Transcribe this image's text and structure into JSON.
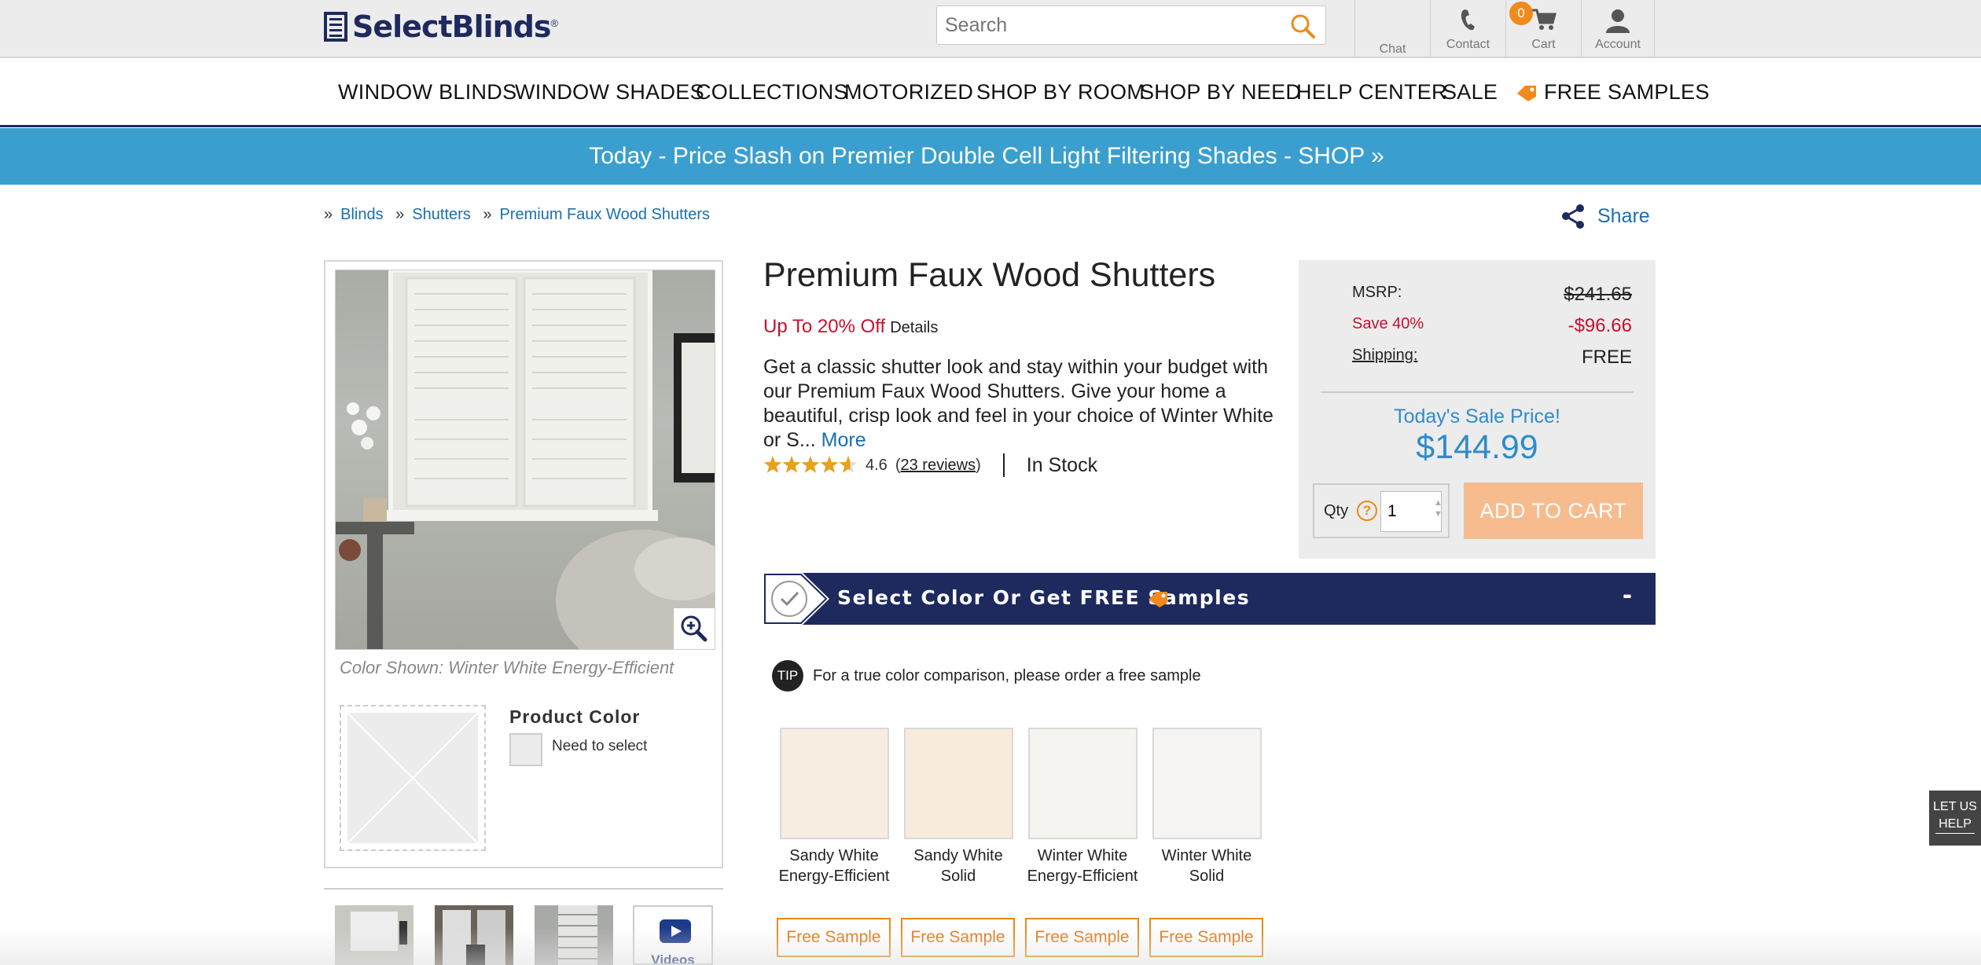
{
  "header": {
    "logo": "SelectBlinds",
    "logo_reg": "®",
    "search_placeholder": "Search",
    "chat": "Chat",
    "contact": "Contact",
    "cart": "Cart",
    "cart_count": "0",
    "account": "Account"
  },
  "nav": [
    "WINDOW BLINDS",
    "WINDOW SHADES",
    "COLLECTIONS",
    "MOTORIZED",
    "SHOP BY ROOM",
    "SHOP BY NEED",
    "HELP CENTER",
    "SALE",
    "FREE SAMPLES"
  ],
  "promo": "Today - Price Slash on Premier Double Cell Light Filtering Shades  -  SHOP »",
  "breadcrumb": [
    "Blinds",
    "Shutters",
    "Premium Faux Wood Shutters"
  ],
  "share": "Share",
  "gallery": {
    "caption": "Color Shown: Winter White Energy-Efficient",
    "product_color_label": "Product Color",
    "product_color_value": "Need to select",
    "videos_label": "Videos"
  },
  "product": {
    "title": "Premium Faux Wood Shutters",
    "discount": "Up To 20% Off",
    "details_link": "Details",
    "description": "Get a classic shutter look and stay within your budget with our Premium Faux Wood Shutters. Give your home a beautiful, crisp look and feel in your choice of Winter White or S...",
    "more_link": "More",
    "rating": 4.6,
    "rating_text": "4.6",
    "reviews_link": "23 reviews",
    "stock": "In Stock"
  },
  "pricing": {
    "msrp_label": "MSRP:",
    "msrp": "$241.65",
    "save_label": "Save 40%",
    "save_amount": "-$96.66",
    "shipping_label": "Shipping:",
    "shipping": "FREE",
    "sale_label": "Today's Sale Price!",
    "sale_price": "$144.99",
    "qty_label": "Qty",
    "qty_help": "?",
    "qty_value": "1",
    "add_to_cart": "ADD TO CART"
  },
  "color_section": {
    "title": "Select Color Or Get FREE Samples",
    "collapse": "-",
    "tip_badge": "TIP",
    "tip": "For a true color comparison, please order a free sample",
    "sample_button": "Free Sample",
    "swatches": [
      {
        "name": "Sandy White Energy-Efficient",
        "color": "#f8ede1"
      },
      {
        "name": "Sandy White Solid",
        "color": "#f8ebdd"
      },
      {
        "name": "Winter White Energy-Efficient",
        "color": "#f5f4f1"
      },
      {
        "name": "Winter White Solid",
        "color": "#f6f5f3"
      }
    ]
  },
  "help_tab": {
    "line1": "LET US",
    "line2": "HELP"
  },
  "colors": {
    "navy": "#1e2a5e",
    "promo_blue": "#3a9fcf",
    "link_blue": "#1a6fb0",
    "sale_red": "#c8102e",
    "orange": "#e88a1a",
    "price_blue": "#2f8cc8"
  }
}
